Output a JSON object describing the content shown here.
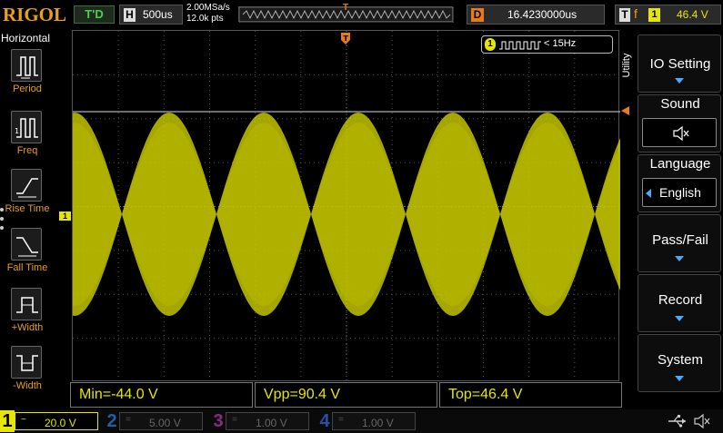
{
  "header": {
    "brand": "RIGOL",
    "run_state": "T'D",
    "horizontal_letter": "H",
    "timebase": "500us",
    "sample_rate": "2.00MSa/s",
    "memory_depth": "12.0k pts",
    "delay_letter": "D",
    "delay": "16.4230000us",
    "trigger_letter": "T",
    "trigger_edge": "f",
    "trigger_source": "1",
    "trigger_level": "46.4 V"
  },
  "left_menu": {
    "title": "Horizontal",
    "items": [
      {
        "label": "Period",
        "icon": "period-icon"
      },
      {
        "label": "Freq",
        "icon": "freq-icon"
      },
      {
        "label": "Rise Time",
        "icon": "rise-time-icon"
      },
      {
        "label": "Fall Time",
        "icon": "fall-time-icon"
      },
      {
        "label": "+Width",
        "icon": "positive-width-icon"
      },
      {
        "label": "-Width",
        "icon": "negative-width-icon"
      }
    ]
  },
  "frequency_counter": {
    "channel": "1",
    "value": "< 15Hz"
  },
  "ch1_marker": "1",
  "measurements": [
    {
      "text": "Min=-44.0 V"
    },
    {
      "text": "Vpp=90.4 V"
    },
    {
      "text": "Top=46.4 V"
    }
  ],
  "right_menu": {
    "tab_label": "Utility",
    "items": [
      {
        "label": "IO Setting"
      },
      {
        "label": "Sound",
        "sub_icon": "speaker-mute-icon"
      },
      {
        "label": "Language",
        "sub_value": "English"
      },
      {
        "label": "Pass/Fail"
      },
      {
        "label": "Record"
      },
      {
        "label": "System"
      }
    ]
  },
  "channels": [
    {
      "num": "1",
      "coupling": "~",
      "scale": "20.0 V",
      "color": "#e6e600",
      "active": true
    },
    {
      "num": "2",
      "coupling": "=",
      "scale": "5.00 V",
      "color": "#1e7fd6",
      "active": false
    },
    {
      "num": "3",
      "coupling": "=",
      "scale": "1.00 V",
      "color": "#c03cc0",
      "active": false
    },
    {
      "num": "4",
      "coupling": "=",
      "scale": "1.00 V",
      "color": "#2a5fd6",
      "active": false
    }
  ],
  "status_icons": [
    "usb-icon",
    "speaker-mute-icon"
  ],
  "colors": {
    "ch1": "#e6e600",
    "trigger": "#e87a1a",
    "accent": "#4aa8ff",
    "brand": "#e8a017"
  }
}
